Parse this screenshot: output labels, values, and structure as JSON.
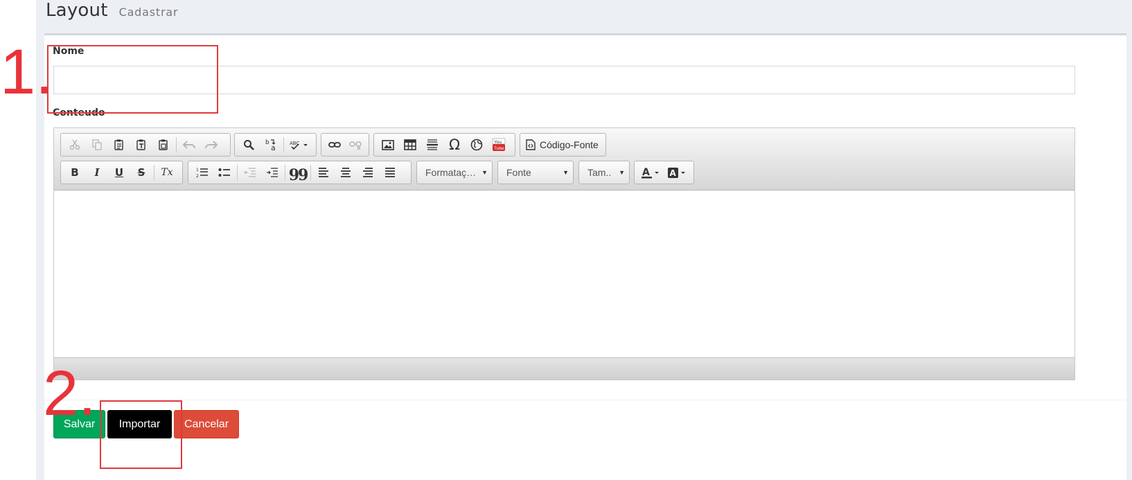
{
  "header": {
    "title": "Layout",
    "subtitle": "Cadastrar"
  },
  "form": {
    "name_label": "Nome",
    "name_value": "",
    "content_label": "Conteudo"
  },
  "editor": {
    "source_label": "Código-Fonte",
    "format_label": "Formataç…",
    "font_label": "Fonte",
    "size_label": "Tam..",
    "icons": {
      "bold": "B",
      "italic": "I",
      "underline": "U",
      "strike": "S",
      "remove_format": "Tx",
      "special_char": "Ω",
      "quote": "99"
    }
  },
  "buttons": {
    "save": "Salvar",
    "import": "Importar",
    "cancel": "Cancelar"
  },
  "annotations": {
    "one": "1.",
    "two": "2."
  },
  "colors": {
    "save": "#00a65a",
    "import": "#000000",
    "cancel": "#dd4b39",
    "annotation": "#e8333b"
  }
}
